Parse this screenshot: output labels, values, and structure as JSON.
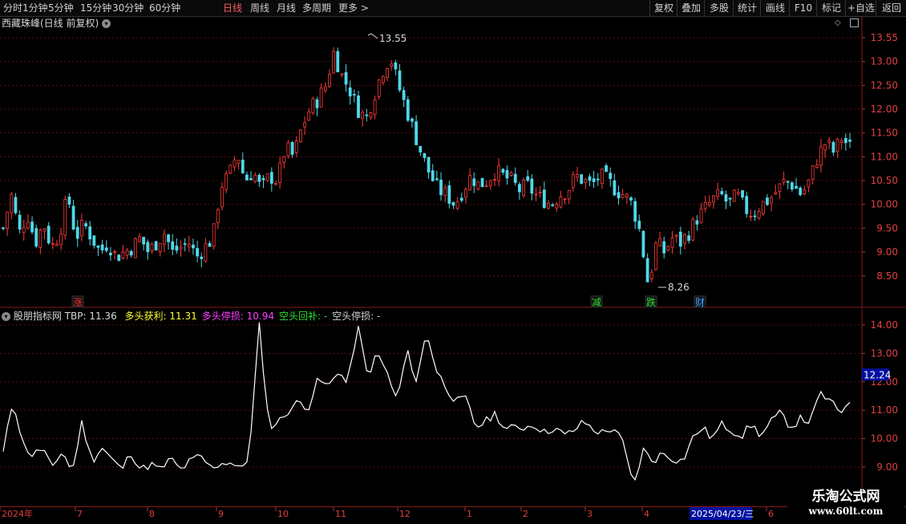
{
  "toolbar": {
    "left_items": [
      "分时",
      "1分钟",
      "5分钟",
      "15分钟",
      "30分钟",
      "60分钟",
      "日线",
      "周线",
      "月线",
      "多周期",
      "更多 >"
    ],
    "active": "日线",
    "right_items": [
      "复权",
      "叠加",
      "多股",
      "统计",
      "画线",
      "F10",
      "标记",
      "+自选",
      "返回"
    ]
  },
  "main_panel": {
    "title": "西藏珠峰(日线 前复权)",
    "price_axis": [
      "13.55",
      "13.00",
      "12.50",
      "12.00",
      "11.50",
      "11.00",
      "10.50",
      "10.00",
      "9.50",
      "9.00",
      "8.50"
    ],
    "high_label": "13.55",
    "low_label": "8.26",
    "signals": [
      {
        "text": "涨",
        "color": "#ff3030"
      },
      {
        "text": "减",
        "color": "#30e030"
      },
      {
        "text": "跌",
        "color": "#30e030"
      },
      {
        "text": "财",
        "color": "#40a0ff"
      }
    ]
  },
  "indicator_panel": {
    "name": "股朋指标网",
    "tbp_label": "TBP:",
    "tbp_value": "11.36",
    "items": [
      {
        "label": "多头获利:",
        "value": "11.31",
        "color": "#ffff30"
      },
      {
        "label": "多头停损:",
        "value": "10.94",
        "color": "#ff40ff"
      },
      {
        "label": "空头回补:",
        "value": "-",
        "color": "#30e030"
      },
      {
        "label": "空头停损:",
        "value": "-",
        "color": "#d0d0d0"
      }
    ],
    "axis": [
      "14.00",
      "13.00",
      "12.00",
      "11.00",
      "10.00",
      "9.00"
    ],
    "current_value": "12.24"
  },
  "date_axis": {
    "labels": [
      "2024年",
      "7",
      "8",
      "9",
      "10",
      "11",
      "12",
      "1",
      "2",
      "3",
      "4",
      "2025/04/23/三",
      "6"
    ]
  },
  "watermark": {
    "title": "乐淘公式网",
    "url": "www.60lt.com"
  },
  "chart_data": [
    {
      "type": "candlestick",
      "title": "西藏珠峰(日线 前复权)",
      "ylim": [
        8.26,
        13.55
      ],
      "annotations": [
        {
          "label": "13.55",
          "type": "high"
        },
        {
          "label": "8.26",
          "type": "low"
        }
      ],
      "x_months": [
        "2024-06",
        "2024-07",
        "2024-08",
        "2024-09",
        "2024-10",
        "2024-11",
        "2024-12",
        "2025-01",
        "2025-02",
        "2025-03",
        "2025-04",
        "2025-05",
        "2025-06"
      ],
      "close_path": [
        9.5,
        10.2,
        9.4,
        9.8,
        9.2,
        9.6,
        9.1,
        9.4,
        10.2,
        9.3,
        9.6,
        9.3,
        9.0,
        9.2,
        8.9,
        9.0,
        9.1,
        9.3,
        9.0,
        9.2,
        9.4,
        9.0,
        9.1,
        9.2,
        8.9,
        9.1,
        9.3,
        10.4,
        10.6,
        11.1,
        10.5,
        10.7,
        10.3,
        10.6,
        10.5,
        11.2,
        11.0,
        11.6,
        12.0,
        12.2,
        12.5,
        13.2,
        12.7,
        12.4,
        12.0,
        11.8,
        12.3,
        12.8,
        13.1,
        12.5,
        12.0,
        11.5,
        11.0,
        10.6,
        10.3,
        10.2,
        10.0,
        10.3,
        10.6,
        10.4,
        10.5,
        10.7,
        10.6,
        10.5,
        10.3,
        10.4,
        10.2,
        10.1,
        10.0,
        10.2,
        10.3,
        10.6,
        10.5,
        10.4,
        10.6,
        10.5,
        10.3,
        10.2,
        10.0,
        9.4,
        8.3,
        9.2,
        9.0,
        9.3,
        9.2,
        9.4,
        9.7,
        9.9,
        10.1,
        10.2,
        10.0,
        10.2,
        9.9,
        9.8,
        10.0,
        10.1,
        10.3,
        10.5,
        10.4,
        10.2,
        10.5,
        11.0,
        11.3,
        11.1,
        11.4,
        11.2
      ]
    },
    {
      "type": "line",
      "title": "",
      "ylim": [
        8.5,
        14.2
      ],
      "values": [
        9.5,
        11.4,
        9.8,
        9.4,
        9.7,
        8.9,
        9.6,
        8.8,
        10.6,
        9.2,
        9.7,
        9.3,
        8.9,
        9.5,
        8.9,
        9.1,
        8.9,
        9.3,
        8.9,
        9.2,
        9.4,
        9.0,
        9.1,
        9.2,
        8.9,
        9.4,
        14.0,
        10.4,
        10.6,
        11.0,
        11.3,
        11.1,
        12.1,
        11.8,
        12.4,
        11.9,
        14.0,
        12.2,
        13.0,
        12.3,
        11.3,
        13.1,
        12.0,
        13.8,
        12.4,
        11.8,
        11.3,
        11.4,
        10.4,
        10.6,
        10.9,
        10.3,
        10.4,
        10.4,
        10.5,
        10.2,
        10.4,
        10.1,
        10.3,
        10.6,
        10.3,
        10.2,
        10.4,
        9.8,
        8.3,
        9.6,
        9.2,
        9.5,
        9.3,
        9.2,
        10.0,
        10.4,
        10.0,
        10.5,
        10.3,
        10.1,
        10.5,
        10.1,
        10.6,
        10.9,
        10.4,
        10.7,
        10.6,
        11.6,
        11.3,
        10.9,
        11.4
      ]
    }
  ]
}
